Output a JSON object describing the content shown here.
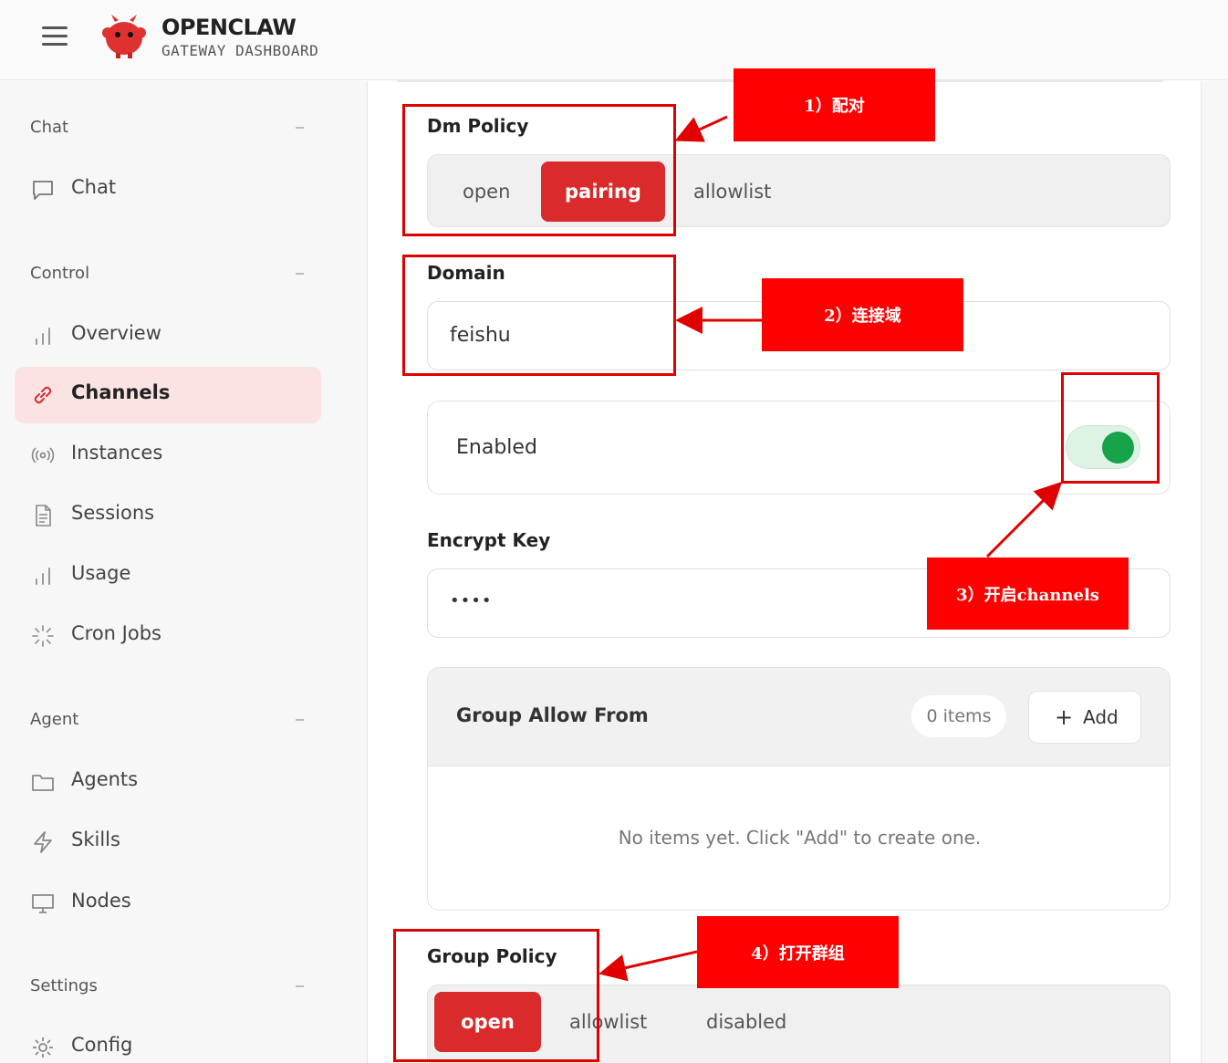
{
  "header": {
    "menu_icon": "hamburger-icon",
    "logo_icon": "red-claw-mascot-icon",
    "title": "OPENCLAW",
    "subtitle": "GATEWAY DASHBOARD"
  },
  "sidebar": {
    "sections": [
      {
        "title": "Chat",
        "items": [
          {
            "label": "Chat",
            "icon": "chat-bubble-icon"
          }
        ]
      },
      {
        "title": "Control",
        "items": [
          {
            "label": "Overview",
            "icon": "bar-chart-icon"
          },
          {
            "label": "Channels",
            "icon": "link-icon",
            "active": true
          },
          {
            "label": "Instances",
            "icon": "broadcast-icon"
          },
          {
            "label": "Sessions",
            "icon": "document-icon"
          },
          {
            "label": "Usage",
            "icon": "bar-chart-icon"
          },
          {
            "label": "Cron Jobs",
            "icon": "loader-icon"
          }
        ]
      },
      {
        "title": "Agent",
        "items": [
          {
            "label": "Agents",
            "icon": "folder-icon"
          },
          {
            "label": "Skills",
            "icon": "lightning-icon"
          },
          {
            "label": "Nodes",
            "icon": "monitor-icon"
          }
        ]
      },
      {
        "title": "Settings",
        "items": [
          {
            "label": "Config",
            "icon": "gear-icon"
          }
        ]
      }
    ]
  },
  "main": {
    "dm_policy": {
      "label": "Dm Policy",
      "options": [
        "open",
        "pairing",
        "allowlist"
      ],
      "selected": "pairing"
    },
    "domain": {
      "label": "Domain",
      "value": "feishu"
    },
    "enabled": {
      "label": "Enabled",
      "value": true
    },
    "encrypt_key": {
      "label": "Encrypt Key",
      "value": "••••"
    },
    "group_allow_from": {
      "title": "Group Allow From",
      "count": "0 items",
      "add_label": "Add",
      "empty_text": "No items yet. Click \"Add\" to create one."
    },
    "group_policy": {
      "label": "Group Policy",
      "options": [
        "open",
        "allowlist",
        "disabled"
      ],
      "selected": "open"
    }
  },
  "annotations": {
    "a1": "1）配对",
    "a2": "2）连接域",
    "a3": "3）开启channels",
    "a4": "4）打开群组",
    "color": "#ff0000"
  },
  "colors": {
    "accent": "#d92b2b",
    "toggle_on": "#16a34a",
    "active_bg": "#fbe3e3"
  }
}
